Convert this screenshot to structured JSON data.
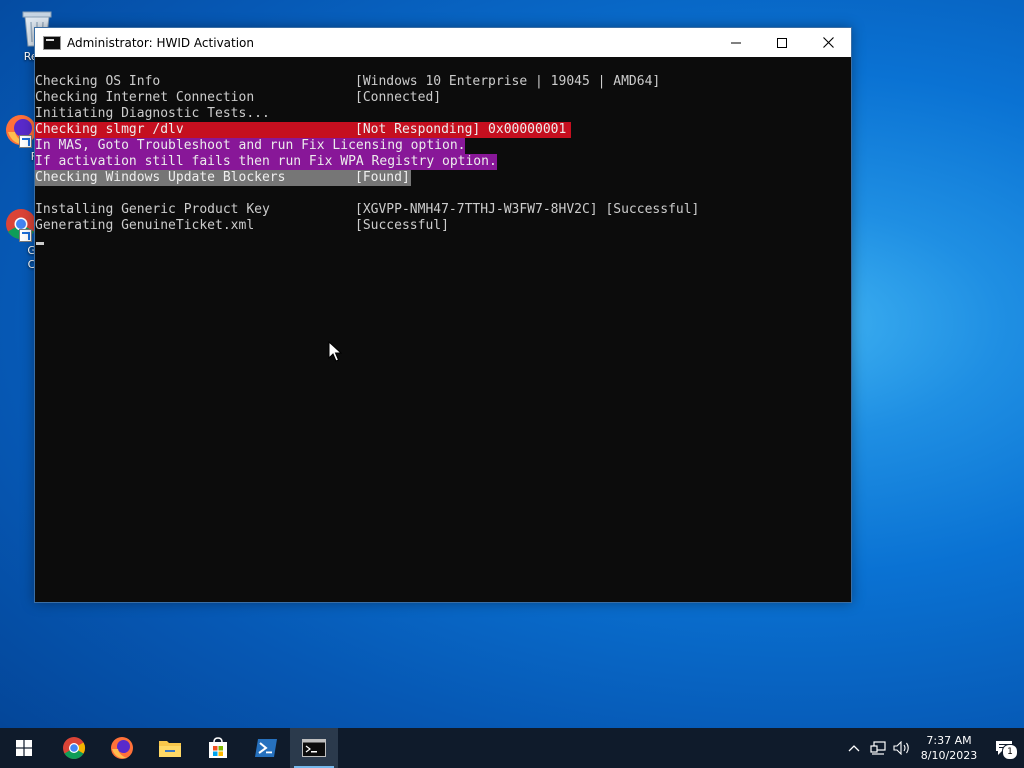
{
  "desktop": {
    "icons": [
      {
        "label": "Recy",
        "icon": "recycle-bin-icon"
      },
      {
        "label": "Fi",
        "icon": "firefox-icon"
      },
      {
        "label": "Go Ch",
        "icon": "chrome-icon"
      }
    ]
  },
  "window": {
    "title": "Administrator:  HWID Activation",
    "controls": {
      "minimize": "minimize-icon",
      "maximize": "maximize-icon",
      "close": "close-icon"
    }
  },
  "console": {
    "lines": [
      {
        "label": "Checking OS Info",
        "status": "[Windows 10 Enterprise | 19045 | AMD64]",
        "style": ""
      },
      {
        "label": "Checking Internet Connection",
        "status": "[Connected]",
        "style": ""
      },
      {
        "label": "Initiating Diagnostic Tests...",
        "status": "",
        "style": ""
      },
      {
        "label": "Checking slmgr /dlv",
        "status": "[Not Responding] 0x00000001",
        "style": "red"
      },
      {
        "label": "In MAS, Goto Troubleshoot and run Fix Licensing option.",
        "status": "",
        "style": "purple"
      },
      {
        "label": "If activation still fails then run Fix WPA Registry option.",
        "status": "",
        "style": "purple"
      },
      {
        "label": "Checking Windows Update Blockers",
        "status": "[Found]",
        "style": "gray"
      },
      {
        "label": "",
        "status": "",
        "style": ""
      },
      {
        "label": "Installing Generic Product Key",
        "status": "[XGVPP-NMH47-7TTHJ-W3FW7-8HV2C] [Successful]",
        "style": ""
      },
      {
        "label": "Generating GenuineTicket.xml",
        "status": "[Successful]",
        "style": ""
      }
    ]
  },
  "taskbar": {
    "apps": [
      "start-icon",
      "chrome-icon",
      "firefox-icon",
      "file-explorer-icon",
      "store-icon",
      "powershell-icon",
      "command-prompt-icon"
    ],
    "clock": {
      "time": "7:37 AM",
      "date": "8/10/2023"
    },
    "notification_count": "1"
  },
  "colors": {
    "console_bg": "#0c0c0c",
    "red": "#c50f1f",
    "purple": "#881798",
    "gray": "#767676",
    "taskbar": "#0f1b2b"
  }
}
